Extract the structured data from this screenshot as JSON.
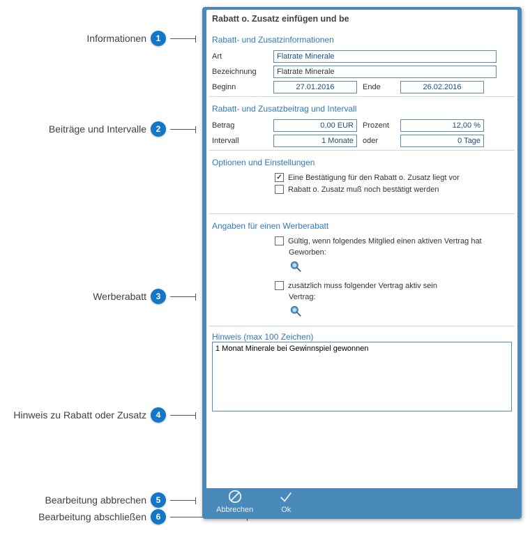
{
  "dialog": {
    "title": "Rabatt o. Zusatz einfügen und be"
  },
  "annotations": [
    {
      "n": "1",
      "label": "Informationen"
    },
    {
      "n": "2",
      "label": "Beiträge und Intervalle"
    },
    {
      "n": "3",
      "label": "Werberabatt"
    },
    {
      "n": "4",
      "label": "Hinweis zu Rabatt oder Zusatz"
    },
    {
      "n": "5",
      "label": "Bearbeitung abbrechen"
    },
    {
      "n": "6",
      "label": "Bearbeitung abschließen"
    }
  ],
  "section_info": {
    "head": "Rabatt- und Zusatzinformationen",
    "art_label": "Art",
    "art_value": "Flatrate Minerale",
    "bez_label": "Bezeichnung",
    "bez_value": "Flatrate Minerale",
    "beginn_label": "Beginn",
    "beginn_value": "27.01.2016",
    "ende_label": "Ende",
    "ende_value": "26.02.2016"
  },
  "section_betrag": {
    "head": "Rabatt- und Zusatzbeitrag und Intervall",
    "betrag_label": "Betrag",
    "betrag_value": "0,00 EUR",
    "prozent_label": "Prozent",
    "prozent_value": "12,00 %",
    "intervall_label": "Intervall",
    "intervall_value": "1 Monate",
    "oder_label": "oder",
    "tage_value": "0 Tage"
  },
  "section_options": {
    "head": "Optionen und Einstellungen",
    "opt_confirm": "Eine Bestätigung für den Rabatt o. Zusatz liegt vor",
    "opt_pending": "Rabatt o. Zusatz muß noch bestätigt werden"
  },
  "section_werbe": {
    "head": "Angaben für einen Werberabatt",
    "cb_member": "Gültig, wenn folgendes Mitglied einen aktiven Vertrag hat",
    "lbl_geworben": "Geworben:",
    "cb_vertrag": "zusätzlich muss folgender Vertrag aktiv sein",
    "lbl_vertrag": "Vertrag:"
  },
  "section_hinweis": {
    "head": "Hinweis (max 100 Zeichen)",
    "value": "1 Monat Minerale bei Gewinnspiel gewonnen"
  },
  "footer": {
    "cancel": "Abbrechen",
    "ok": "Ok"
  }
}
